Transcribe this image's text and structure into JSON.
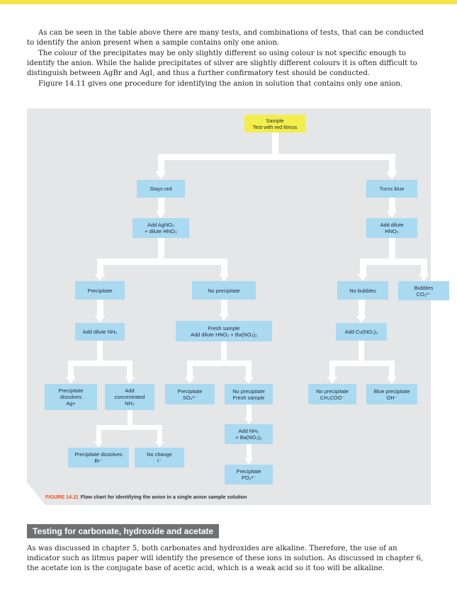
{
  "intro": {
    "p1": "As can be seen in the table above there are many tests, and combinations of tests, that can be conducted to identify the anion present when a sample contains only one anion.",
    "p2": "The colour of the precipitates may be only slightly different so using colour is not specific enough to identify the anion. While the halide precipitates of silver are slightly different colours it is often difficult to distinguish between AgBr and AgI, and thus a further confirmatory test should be conducted.",
    "p3": "Figure 14.11 gives one procedure for identifying the anion in solution that contains only one anion."
  },
  "flowchart": {
    "sample": [
      "Sample",
      "Test with red litmus"
    ],
    "stays_red": [
      "Stays red"
    ],
    "turns_blue": [
      "Turns blue"
    ],
    "add_agno3": [
      "Add AgNO₃",
      "+ dilute HNO₃"
    ],
    "add_dilute_hno3": [
      "Add dilute",
      "HNO₃"
    ],
    "precipitate": [
      "Precipitate"
    ],
    "no_precipitate": [
      "No precipitate"
    ],
    "no_bubbles": [
      "No bubbles"
    ],
    "bubbles": [
      "Bubbles",
      "CO₃²⁻"
    ],
    "add_dilute_nh3": [
      "Add dilute NH₃"
    ],
    "fresh_sample": [
      "Fresh sample",
      "Add dilute HNO₃ + Ba(NO₃)₂"
    ],
    "add_cuno3": [
      "Add Cu(NO₃)₂"
    ],
    "ppt_dissolves_ag": [
      "Precipitate",
      "dissolves",
      "Ag+"
    ],
    "add_conc_nh3": [
      "Add",
      "concentrated",
      "NH₃"
    ],
    "ppt_so4": [
      "Precipitate",
      "SO₄²⁻"
    ],
    "no_ppt_fresh": [
      "No precipitate",
      "Fresh sample"
    ],
    "no_ppt_acetate": [
      "No precipitate",
      "CH₃COO⁻"
    ],
    "blue_ppt": [
      "Blue precipitate",
      "OH⁻"
    ],
    "add_nh3_ba": [
      "Add NH₃",
      "+ Ba(NO₃)₂"
    ],
    "ppt_dissolves_br": [
      "Precipitate dissolves",
      "Br⁻"
    ],
    "no_change": [
      "No change",
      "I⁻"
    ],
    "ppt_po4": [
      "Precipitate",
      "PO₄³⁻"
    ],
    "caption_label": "FIGURE 14.11",
    "caption_text": "Flow chart for identifying the anion in a single anion sample solution"
  },
  "section": {
    "heading": "Testing for carbonate, hydroxide and acetate",
    "body": "As was discussed in chapter 5, both carbonates and hydroxides are alkaline. Therefore, the use of an indicator such as litmus paper will identify the presence of these ions in solution. As discussed in chapter 6, the acetate ion is the conjugate base of acetic acid, which is a weak acid so it too will be alkaline."
  },
  "colors": {
    "box": "#a9daf2",
    "sample_box": "#f3ee4b",
    "panel": "#e5e6e7",
    "caption_accent": "#e8501b",
    "heading_bg": "#707173",
    "top_rule": "#f4e64a"
  }
}
